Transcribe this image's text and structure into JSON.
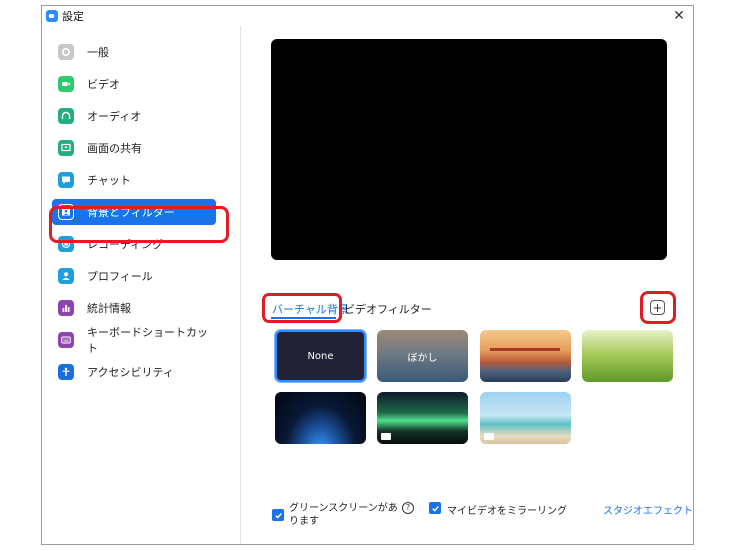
{
  "window": {
    "title": "設定",
    "close_glyph": "✕"
  },
  "sidebar": {
    "items": [
      {
        "label": "一般",
        "icon": "gear-icon",
        "color": "#c7c7c7"
      },
      {
        "label": "ビデオ",
        "icon": "video-camera-icon",
        "color": "#2ecc71"
      },
      {
        "label": "オーディオ",
        "icon": "headphones-icon",
        "color": "#23b07a"
      },
      {
        "label": "画面の共有",
        "icon": "share-screen-icon",
        "color": "#23b07a"
      },
      {
        "label": "チャット",
        "icon": "chat-bubble-icon",
        "color": "#1e9fd9"
      },
      {
        "label": "背景とフィルター",
        "icon": "portrait-icon",
        "color": "#1a73e8",
        "active": true
      },
      {
        "label": "レコーディング",
        "icon": "record-icon",
        "color": "#1e9fd9"
      },
      {
        "label": "プロフィール",
        "icon": "person-icon",
        "color": "#1e9fd9"
      },
      {
        "label": "統計情報",
        "icon": "bar-chart-icon",
        "color": "#8e44ad"
      },
      {
        "label": "キーボードショートカット",
        "icon": "keyboard-icon",
        "color": "#8e44ad"
      },
      {
        "label": "アクセシビリティ",
        "icon": "accessibility-icon",
        "color": "#1a6ee0"
      }
    ]
  },
  "tabs": {
    "virtual_background": "バーチャル背景",
    "video_filter": "ビデオフィルター"
  },
  "add_button": "+",
  "backgrounds": [
    {
      "label": "None",
      "selected": true
    },
    {
      "label": "ぼかし"
    },
    {
      "label": "",
      "icon": "golden-gate-bridge-image"
    },
    {
      "label": "",
      "icon": "grass-image"
    },
    {
      "label": "",
      "icon": "earth-from-space-image"
    },
    {
      "label": "",
      "icon": "aurora-image",
      "video": true
    },
    {
      "label": "",
      "icon": "beach-palm-image",
      "video": true
    }
  ],
  "footer": {
    "green_screen_label": "グリーンスクリーンがあります",
    "green_screen_checked": true,
    "help_glyph": "?",
    "mirror_label": "マイビデオをミラーリング",
    "mirror_checked": true,
    "studio_effects_link": "スタジオエフェクト"
  },
  "colors": {
    "accent": "#1a73e8",
    "highlight": "#e01c24"
  }
}
